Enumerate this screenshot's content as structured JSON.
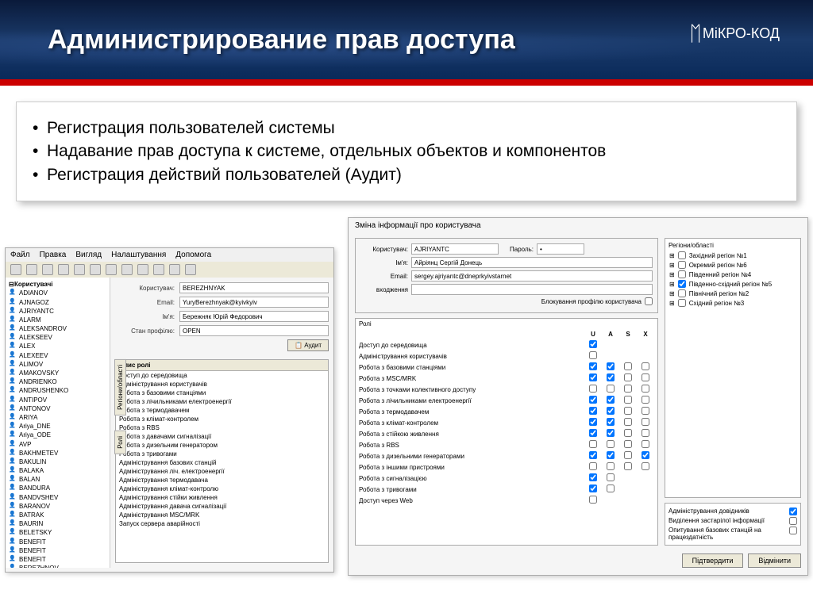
{
  "header": {
    "title": "Администрирование прав доступа",
    "logo": "МіКРО-КОД"
  },
  "bullets": [
    "Регистрация пользователей системы",
    "Надавание прав доступа к системе, отдельных  объектов и компонентов",
    "Регистрация  действий  пользователей  (Аудит)"
  ],
  "main": {
    "menu": [
      "Файл",
      "Правка",
      "Вигляд",
      "Налаштування",
      "Допомога"
    ],
    "tree_root": "Користувачі",
    "users": [
      "ADIANOV",
      "AJNAGOZ",
      "AJRIYANTC",
      "ALARM",
      "ALEKSANDROV",
      "ALEKSEEV",
      "ALEX",
      "ALEXEEV",
      "ALIMOV",
      "AMAKOVSKY",
      "ANDRIENKO",
      "ANDRUSHENKO",
      "ANTIPOV",
      "ANTONOV",
      "ARIYA",
      "Ariya_DNE",
      "Ariya_ODE",
      "AVP",
      "BAKHMETEV",
      "BAKULIN",
      "BALAKA",
      "BALAN",
      "BANDURA",
      "BANDVSHEV",
      "BARANOV",
      "BATRAK",
      "BAURIN",
      "BELETSKY",
      "BENEFIT",
      "BENEFIT",
      "BENEFIT",
      "BEREZHNOV"
    ],
    "form": {
      "user_lbl": "Користувач:",
      "user_val": "BEREZHNYAK",
      "email_lbl": "Email:",
      "email_val": "YuryBerezhnyak@kyivkyiv",
      "name_lbl": "Ім'я:",
      "name_val": "Бережняк Юрій Федорович",
      "state_lbl": "Стан профілю:",
      "state_val": "OPEN",
      "audit_btn": "📋 Аудит"
    },
    "vtab1": "Регіони/області",
    "vtab2": "Ролі",
    "roles_hdr": "Опис ролі",
    "roles": [
      "Доступ до середовища",
      "Адміністрування користувачів",
      "Робота з базовими станціями",
      "Робота з лічильниками електроенергії",
      "Робота з термодавачем",
      "Робота з клімат-контролем",
      "Робота з RBS",
      "Робота з давачами сигналізації",
      "Робота з дизельним генератором",
      "Робота з тривогами",
      "Адміністрування базових станцій",
      "Адміністрування ліч. електроенергії",
      "Адміністрування термодавача",
      "Адміністрування клімат-контролю",
      "Адміністрування стійки живлення",
      "Адміністрування давача сигналізації",
      "Адміністрування MSC/MRK",
      "Запуск сервера аварійності"
    ]
  },
  "dlg": {
    "title": "Зміна інформації про користувача",
    "user_lbl": "Користувач:",
    "user_val": "AJRIYANTC",
    "pwd_lbl": "Пароль:",
    "pwd_val": "•",
    "name_lbl": "Ім'я:",
    "name_val": "Айріянц Сергій Донець",
    "email_lbl": "Email:",
    "email_val": "sergey.ajriyantc@dneprkyivstarnet",
    "login_lbl": "входження",
    "block_lbl": "Блокування профілю користувача",
    "roles_title": "Ролі",
    "cols": [
      "U",
      "A",
      "S",
      "X"
    ],
    "rows": [
      {
        "l": "Доступ до середовища",
        "c": [
          1,
          null,
          null,
          null
        ]
      },
      {
        "l": "Адміністрування користувачів",
        "c": [
          0,
          null,
          null,
          null
        ]
      },
      {
        "l": "Робота з базовими станціями",
        "c": [
          1,
          1,
          0,
          0
        ]
      },
      {
        "l": "Робота з MSC/MRK",
        "c": [
          1,
          1,
          0,
          0
        ]
      },
      {
        "l": "Робота з точками колективного доступу",
        "c": [
          0,
          0,
          0,
          0
        ]
      },
      {
        "l": "Робота з лічильниками електроенергії",
        "c": [
          1,
          1,
          0,
          0
        ]
      },
      {
        "l": "Робота з термодавачем",
        "c": [
          1,
          1,
          0,
          0
        ]
      },
      {
        "l": "Робота з клімат-контролем",
        "c": [
          1,
          1,
          0,
          0
        ]
      },
      {
        "l": "Робота з стійкою живлення",
        "c": [
          1,
          1,
          0,
          0
        ]
      },
      {
        "l": "Робота з RBS",
        "c": [
          0,
          0,
          0,
          0
        ]
      },
      {
        "l": "Робота з дизельними генераторами",
        "c": [
          1,
          1,
          0,
          1
        ]
      },
      {
        "l": "Робота з іншими пристроями",
        "c": [
          0,
          0,
          0,
          0
        ]
      },
      {
        "l": "Робота з сигналізацією",
        "c": [
          1,
          0,
          null,
          null
        ]
      },
      {
        "l": "Робота з тривогами",
        "c": [
          1,
          0,
          null,
          null
        ]
      },
      {
        "l": "Доступ через Web",
        "c": [
          0,
          null,
          null,
          null
        ]
      }
    ],
    "regions_title": "Регіони/області",
    "regions": [
      {
        "l": "Західний регіон №1",
        "c": 0
      },
      {
        "l": "Окремий регіон №6",
        "c": 0
      },
      {
        "l": "Південний регіон №4",
        "c": 0
      },
      {
        "l": "Південно-східний регіон №5",
        "c": 1
      },
      {
        "l": "Північний регіон №2",
        "c": 0
      },
      {
        "l": "Східний регіон №3",
        "c": 0
      }
    ],
    "opts": [
      {
        "l": "Адміністрування довідників",
        "c": 1
      },
      {
        "l": "Виділення застарілої інформації",
        "c": 0
      },
      {
        "l": "Опитування базових станцій на працездатність",
        "c": 0
      }
    ],
    "ok_btn": "Підтвердити",
    "cancel_btn": "Відмінити"
  }
}
